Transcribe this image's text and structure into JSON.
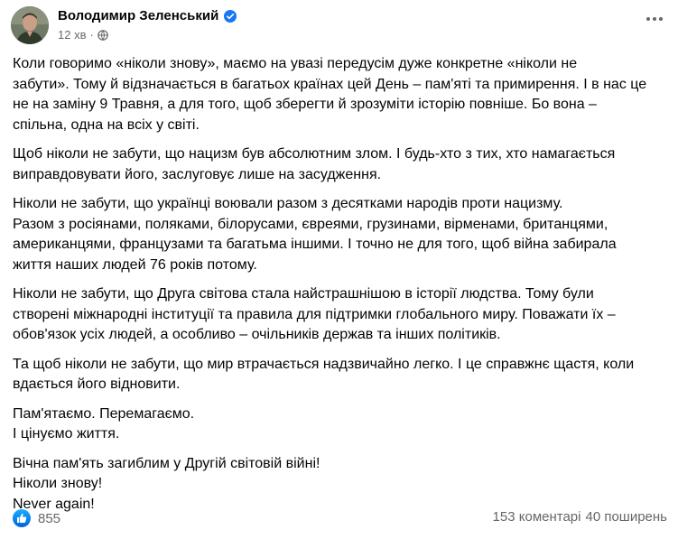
{
  "post": {
    "author": "Володимир Зеленський",
    "time": "12 хв",
    "separator": "·",
    "paragraphs": [
      "Коли говоримо «ніколи знову», маємо на увазі передусім дуже конкретне «ніколи не\nзабути». Тому й відзначається в багатьох країнах цей День – пам'яті та примирення. І в нас це\nне на заміну 9 Травня, а для того, щоб зберегти й зрозуміти історію повніше. Бо вона –\nспільна, одна на всіх у світі.",
      "Щоб ніколи не забути, що нацизм був абсолютним злом. І будь-хто з тих, хто намагається\nвиправдовувати його, заслуговує лише на засудження.",
      "Ніколи не забути, що українці воювали разом з десятками народів проти нацизму.\nРазом з росіянами, поляками, білорусами, євреями, грузинами, вірменами, британцями,\nамериканцями, французами та багатьма іншими. І точно не для того, щоб війна забирала\nжиття наших людей 76 років потому.",
      "Ніколи не забути, що Друга світова стала найстрашнішою в історії людства. Тому були\nстворені міжнародні інституції та правила для підтримки глобального миру. Поважати їх –\nобов'язок усіх людей, а особливо – очільників держав та інших політиків.",
      "Та щоб ніколи не забути, що мир втрачається надзвичайно легко. І це справжнє щастя, коли\nвдається його відновити.",
      "Пам'ятаємо. Перемагаємо.\nІ цінуємо життя.",
      "Вічна пам'ять загиблим у Другій світовій війні!\nНіколи знову!\nNever again!"
    ]
  },
  "footer": {
    "reaction_count": "855",
    "comments": "153 коментарі",
    "shares": "40 поширень"
  },
  "icons": {
    "verified": "verified-badge-icon",
    "privacy": "globe-icon",
    "more": "more-options-icon",
    "like": "like-reaction-icon"
  },
  "colors": {
    "accent": "#1877f2",
    "secondary_text": "#65676b",
    "primary_text": "#050505"
  }
}
